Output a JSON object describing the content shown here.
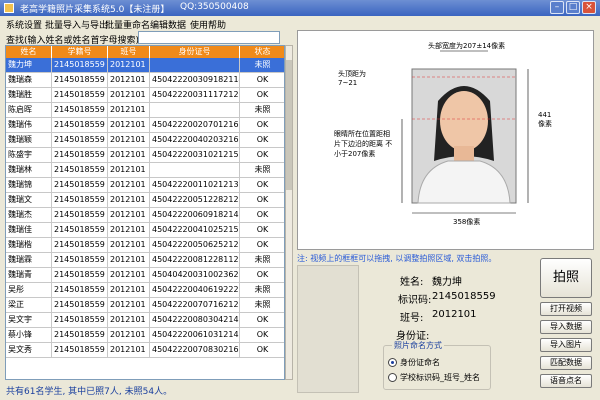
{
  "window": {
    "title": "老高学籍照片采集系统5.0【未注册】",
    "qq": "QQ:350500408"
  },
  "menu": [
    "系统设置",
    "批量导入与导出",
    "批量重命名",
    "编辑数据",
    "使用帮助"
  ],
  "search": {
    "label": "查找(输入姓名或姓名首字母搜索)",
    "value": ""
  },
  "table": {
    "headers": [
      "姓名",
      "学籍号",
      "班号",
      "身份证号",
      "状态"
    ],
    "rows": [
      [
        "魏力坤",
        "2145018559",
        "2012101",
        "",
        "未照"
      ],
      [
        "魏瑞森",
        "2145018559",
        "2012101",
        "450422200309182114",
        "OK"
      ],
      [
        "魏瑞胜",
        "2145018559",
        "2012101",
        "450422200311172126",
        "OK"
      ],
      [
        "陈启晖",
        "2145018559",
        "2012101",
        "",
        "未照"
      ],
      [
        "魏瑞伟",
        "2145018559",
        "2012101",
        "450422200207012165",
        "OK"
      ],
      [
        "魏瑞颖",
        "2145018559",
        "2012101",
        "450422200402032161",
        "OK"
      ],
      [
        "陈盛宇",
        "2145018559",
        "2012101",
        "450422200310212157",
        "OK"
      ],
      [
        "魏瑞林",
        "2145018559",
        "2012101",
        "",
        "未照"
      ],
      [
        "魏瑞锦",
        "2145018559",
        "2012101",
        "450422200110212136",
        "OK"
      ],
      [
        "魏瑞文",
        "2145018559",
        "2012101",
        "450422200512282129",
        "OK"
      ],
      [
        "魏瑞杰",
        "2145018559",
        "2012101",
        "450422200609182140",
        "OK"
      ],
      [
        "魏瑞佳",
        "2145018559",
        "2012101",
        "450422200410252156",
        "OK"
      ],
      [
        "魏瑞楷",
        "2145018559",
        "2012101",
        "450422200506252126",
        "OK"
      ],
      [
        "魏瑞霖",
        "2145018559",
        "2012101",
        "450422200812281120",
        "未照"
      ],
      [
        "魏瑞青",
        "2145018559",
        "2012101",
        "450404200310023628",
        "OK"
      ],
      [
        "吴彤",
        "2145018559",
        "2012101",
        "450422200406192220",
        "未照"
      ],
      [
        "梁正",
        "2145018559",
        "2012101",
        "450422200707162127",
        "未照"
      ],
      [
        "吴文宇",
        "2145018559",
        "2012101",
        "450422200803042141",
        "OK"
      ],
      [
        "蔡小锋",
        "2145018559",
        "2012101",
        "450422200610312141",
        "OK"
      ],
      [
        "吴文秀",
        "2145018559",
        "2012101",
        "450422200708302160",
        "OK"
      ]
    ]
  },
  "status_text": "共有61名学生, 其中已照7人, 未照54人。",
  "photo_guide": {
    "top_note": "头部宽度为207±14像素",
    "top_margin": "头顶距为\n7~21",
    "right_note": "441像素",
    "eye_note": "眼睛所在位置距相片下边沿的距离\n不小于207像素",
    "bottom_note": "358像素"
  },
  "notice": "注: 视频上的框框可以拖拽, 以调整拍照区域, 双击拍照。",
  "info": {
    "name_label": "姓名:",
    "name_value": "魏力坤",
    "id_label": "标识码:",
    "id_value": "2145018559",
    "class_label": "班号:",
    "class_value": "2012101",
    "idcard_label": "身份证:",
    "idcard_value": ""
  },
  "naming": {
    "title": "照片命名方式",
    "option1": "身份证命名",
    "option2": "学校标识码_班号_姓名"
  },
  "buttons": {
    "capture": "拍照",
    "open_video": "打开视频",
    "import": "导入数据",
    "import_photo": "导入图片",
    "match": "匹配数据",
    "voice": "语音点名"
  },
  "colors": {
    "accent": "#f08a1a",
    "selection": "#3a6fd8",
    "titlebar": "#3a64c0"
  }
}
